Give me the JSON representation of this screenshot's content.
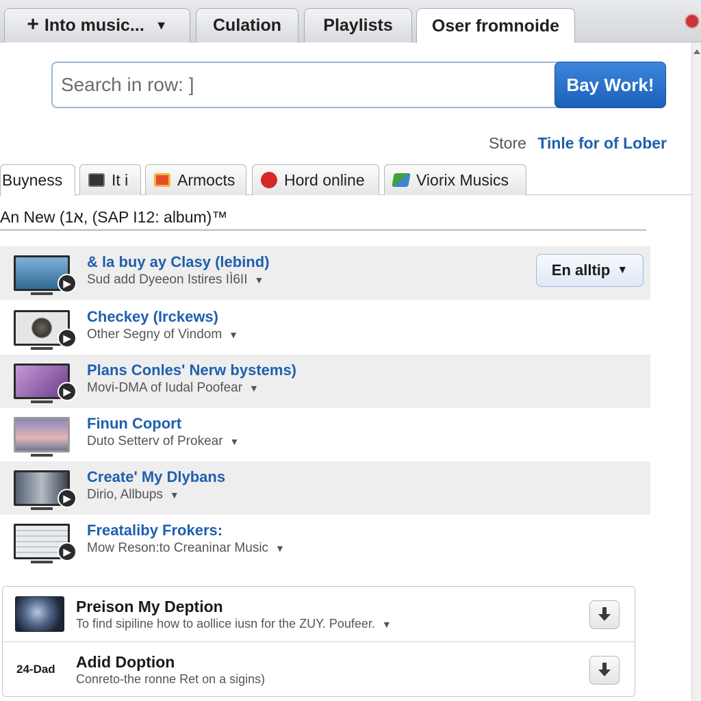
{
  "top_tabs": [
    {
      "label": "Into music...",
      "leading_icon": "plus-icon",
      "trailing_icon": "caret-down-icon"
    },
    {
      "label": "Culation"
    },
    {
      "label": "Playlists"
    },
    {
      "label": "Oser fromnoide",
      "active": true
    }
  ],
  "search": {
    "placeholder": "Search in row: ]",
    "button_label": "Bay Work!"
  },
  "store": {
    "label": "Store",
    "link": "Tinle for of Lober"
  },
  "sub_tabs": [
    {
      "label": "Buyness",
      "active": true
    },
    {
      "label": "It i",
      "icon": "monitor-icon"
    },
    {
      "label": "Armocts",
      "icon": "box-icon"
    },
    {
      "label": "Hord online",
      "icon": "red-circle-icon"
    },
    {
      "label": "Viorix Musics",
      "icon": "green-diamond-icon"
    }
  ],
  "section_heading": "An New (א1, (SAP I12: album)™",
  "list": [
    {
      "title": "& la buy ay Clasy (lebind)",
      "subtitle": "Sud add Dyeeon Istires IÌ6II",
      "dropdown": "En alltip",
      "thumb_color": "#4d8fbf"
    },
    {
      "title": "Checkey (Irckews)",
      "subtitle": "Other Segny of Vindom",
      "thumb_color": "#5e5a54"
    },
    {
      "title": "Plans Conles' Nerw bystems)",
      "subtitle": "Movi-DMA of Iudal Poofear",
      "thumb_color": "#8d5fa0"
    },
    {
      "title": "Finun Coport",
      "subtitle": "Duto Setterv of Prokear",
      "thumb_color": "#9f8fb0"
    },
    {
      "title": "Create' My Dlybans",
      "subtitle": "Dirio, Allbups",
      "thumb_color": "#6f7a88"
    },
    {
      "title": "Freataliby Frokers:",
      "subtitle": "Mow Reson:to Creaninar Music",
      "thumb_color": "#d8dbe0"
    }
  ],
  "card": [
    {
      "title": "Preison My Deption",
      "subtitle": "To find sipiline how to aollice iusn for the ZUY. Poufeer.",
      "has_thumb": true
    },
    {
      "title": "Adid Doption",
      "subtitle": "Conreto-the ronne Ret on a sigins)",
      "left_label": "24-Dad"
    }
  ],
  "colors": {
    "link_blue": "#1f5fae",
    "button_blue": "#2a72cb"
  }
}
